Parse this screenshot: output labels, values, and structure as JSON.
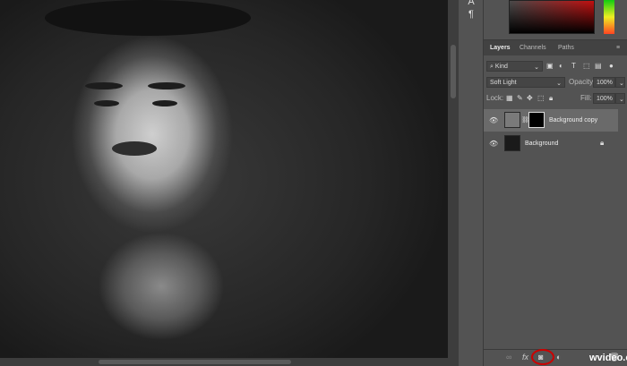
{
  "panel": {
    "tabs": [
      "Layers",
      "Channels",
      "Paths"
    ],
    "filter": {
      "label": "Kind",
      "icon": "search-icon"
    },
    "blend_mode": "Soft Light",
    "opacity": {
      "label": "Opacity:",
      "value": "100%"
    },
    "lock_label": "Lock:",
    "fill": {
      "label": "Fill:",
      "value": "100%"
    },
    "layers": [
      {
        "name": "Background copy",
        "visible": true,
        "selected": true
      },
      {
        "name": "Background",
        "visible": true,
        "locked": true
      }
    ],
    "bottom_icons": [
      "link-icon",
      "fx-icon",
      "add-mask-icon",
      "adjustment-icon",
      "folder-icon",
      "new-layer-icon",
      "trash-icon"
    ],
    "highlight_color": "#cc0000"
  },
  "toolbar": {
    "icons": [
      "character-icon",
      "paragraph-icon"
    ],
    "paragraph_glyph": "¶"
  },
  "watermark": "wvideo.com"
}
